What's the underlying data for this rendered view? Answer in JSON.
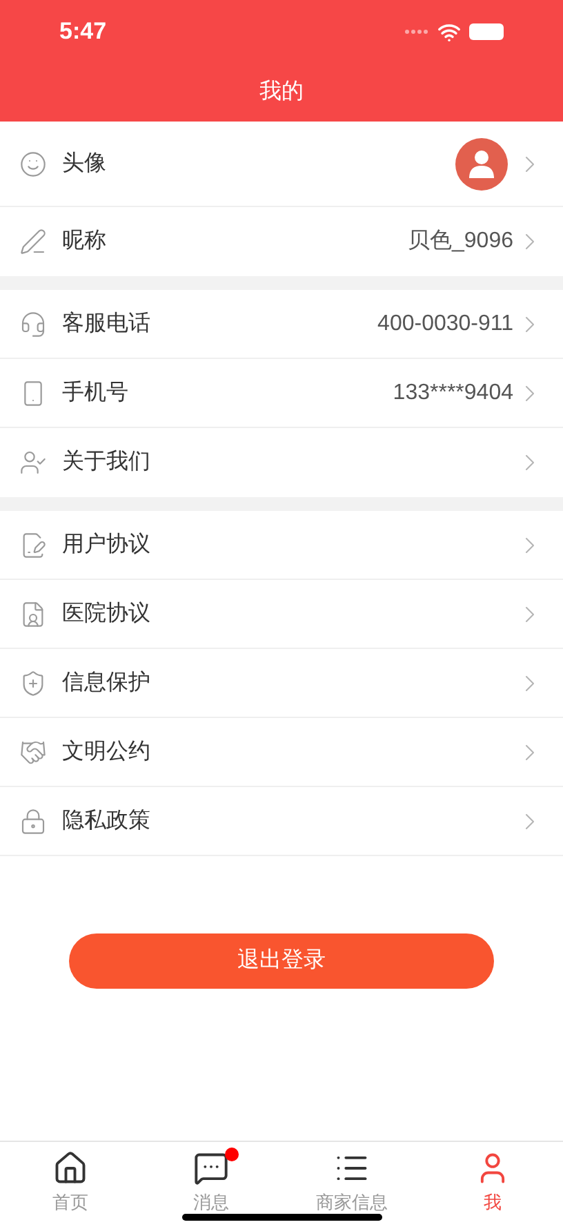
{
  "status_bar": {
    "time": "5:47"
  },
  "header": {
    "title": "我的"
  },
  "sections": [
    {
      "rows": [
        {
          "kind": "avatar",
          "label": "头像"
        },
        {
          "kind": "value",
          "label": "昵称",
          "value": "贝色_9096"
        }
      ]
    },
    {
      "rows": [
        {
          "kind": "value",
          "label": "客服电话",
          "value": "400-0030-911"
        },
        {
          "kind": "value",
          "label": "手机号",
          "value": "133****9404"
        },
        {
          "kind": "plain",
          "label": "关于我们"
        }
      ]
    },
    {
      "rows": [
        {
          "kind": "plain",
          "label": "用户协议"
        },
        {
          "kind": "plain",
          "label": "医院协议"
        },
        {
          "kind": "plain",
          "label": "信息保护"
        },
        {
          "kind": "plain",
          "label": "文明公约"
        },
        {
          "kind": "plain",
          "label": "隐私政策"
        }
      ]
    }
  ],
  "logout_button": "退出登录",
  "tab_bar": [
    {
      "label": "首页",
      "selected": false,
      "badge": false
    },
    {
      "label": "消息",
      "selected": false,
      "badge": true
    },
    {
      "label": "商家信息",
      "selected": false,
      "badge": false
    },
    {
      "label": "我",
      "selected": true,
      "badge": false
    }
  ]
}
